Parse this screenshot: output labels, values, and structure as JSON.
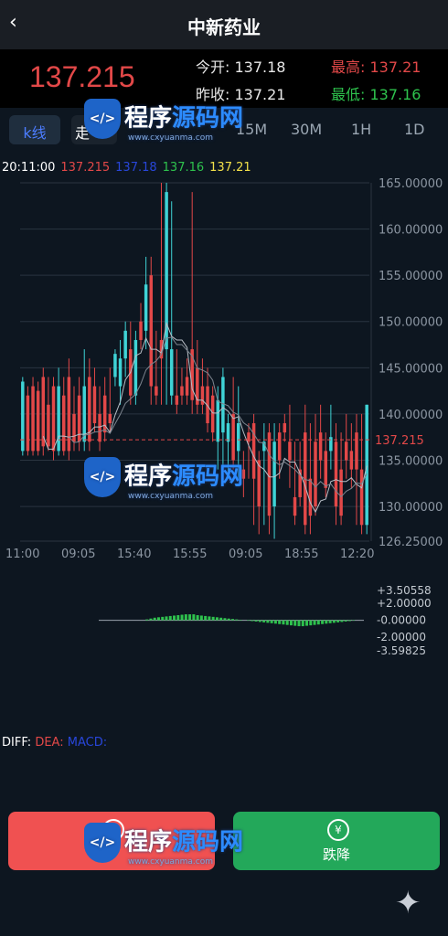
{
  "header": {
    "title": "中新药业",
    "back_icon": "chevron-left-icon"
  },
  "quote": {
    "price": "137.215",
    "open_label": "今开:",
    "open_value": "137.18",
    "high_label": "最高:",
    "high_value": "137.21",
    "prev_label": "昨收:",
    "prev_value": "137.21",
    "low_label": "最低:",
    "low_value": "137.16"
  },
  "tabs": [
    {
      "label": "k线",
      "active": true
    },
    {
      "label": "走"
    },
    {
      "label": "15M"
    },
    {
      "label": "30M"
    },
    {
      "label": "1H"
    },
    {
      "label": "1D"
    }
  ],
  "legend": {
    "time": "20:11:00",
    "v1": "137.215",
    "v2": "137.18",
    "v3": "137.16",
    "v4": "137.21"
  },
  "colors": {
    "up": "#e24848",
    "down": "#3fd3d6",
    "bg": "#0d1620",
    "high": "#e24848",
    "low": "#2ec24d",
    "legend_blue": "#2846d9",
    "legend_yellow": "#f2e04a"
  },
  "chart_data": {
    "type": "candlestick",
    "y_ticks": [
      "165.00000",
      "160.00000",
      "155.00000",
      "150.00000",
      "145.00000",
      "140.00000",
      "135.00000",
      "130.00000",
      "126.25000"
    ],
    "ylim": [
      126.25,
      165
    ],
    "x_ticks": [
      "11:00",
      "09:05",
      "15:40",
      "15:55",
      "09:05",
      "18:55",
      "12:20"
    ],
    "current_price_label": "137.215",
    "current_price": 137.215,
    "macd_ticks": [
      "+3.50558",
      "+2.00000",
      "-0.00000",
      "-2.00000",
      "-3.59825"
    ],
    "macd_ylim": [
      -3.59825,
      3.50558
    ],
    "macd_labels": {
      "diff": "DIFF:",
      "dea": "DEA:",
      "macd": "MACD:"
    },
    "candles": [
      {
        "o": 136,
        "c": 143.5,
        "h": 144,
        "l": 135.5
      },
      {
        "o": 142,
        "c": 136,
        "h": 143,
        "l": 135.5
      },
      {
        "o": 143,
        "c": 136,
        "h": 144,
        "l": 135.5
      },
      {
        "o": 142.5,
        "c": 136,
        "h": 143.5,
        "l": 135.5
      },
      {
        "o": 144,
        "c": 136.5,
        "h": 145,
        "l": 135.5
      },
      {
        "o": 141,
        "c": 136.5,
        "h": 144,
        "l": 136
      },
      {
        "o": 143,
        "c": 136,
        "h": 144,
        "l": 135
      },
      {
        "o": 136,
        "c": 143,
        "h": 145,
        "l": 135.5
      },
      {
        "o": 142,
        "c": 136,
        "h": 144,
        "l": 135.5
      },
      {
        "o": 144,
        "c": 136,
        "h": 146,
        "l": 135
      },
      {
        "o": 140,
        "c": 137,
        "h": 143,
        "l": 136
      },
      {
        "o": 142,
        "c": 137,
        "h": 144,
        "l": 136
      },
      {
        "o": 137,
        "c": 143,
        "h": 147,
        "l": 136
      },
      {
        "o": 144,
        "c": 137,
        "h": 146,
        "l": 136
      },
      {
        "o": 143,
        "c": 139,
        "h": 145,
        "l": 138
      },
      {
        "o": 140,
        "c": 137,
        "h": 143,
        "l": 136
      },
      {
        "o": 142,
        "c": 138,
        "h": 144,
        "l": 137
      },
      {
        "o": 140,
        "c": 139,
        "h": 145,
        "l": 138
      },
      {
        "o": 144,
        "c": 146.5,
        "h": 147,
        "l": 143
      },
      {
        "o": 143,
        "c": 146,
        "h": 148,
        "l": 141
      },
      {
        "o": 146,
        "c": 149,
        "h": 150,
        "l": 144
      },
      {
        "o": 147,
        "c": 142,
        "h": 150,
        "l": 141
      },
      {
        "o": 142,
        "c": 148,
        "h": 149,
        "l": 141
      },
      {
        "o": 150,
        "c": 148,
        "h": 152,
        "l": 147
      },
      {
        "o": 149,
        "c": 154,
        "h": 157,
        "l": 147
      },
      {
        "o": 155,
        "c": 143,
        "h": 157,
        "l": 141
      },
      {
        "o": 143,
        "c": 142,
        "h": 149,
        "l": 141
      },
      {
        "o": 148,
        "c": 146,
        "h": 165,
        "l": 141
      },
      {
        "o": 147,
        "c": 164,
        "h": 165,
        "l": 141
      },
      {
        "o": 142,
        "c": 147,
        "h": 163,
        "l": 141
      },
      {
        "o": 142,
        "c": 141,
        "h": 147,
        "l": 140
      },
      {
        "o": 143,
        "c": 142,
        "h": 145,
        "l": 141
      },
      {
        "o": 144,
        "c": 142,
        "h": 146,
        "l": 141
      },
      {
        "o": 147,
        "c": 141.5,
        "h": 164,
        "l": 140
      },
      {
        "o": 145,
        "c": 141,
        "h": 148,
        "l": 140
      },
      {
        "o": 143,
        "c": 141,
        "h": 146,
        "l": 140
      },
      {
        "o": 143,
        "c": 139,
        "h": 145,
        "l": 138
      },
      {
        "o": 142,
        "c": 138,
        "h": 143,
        "l": 137
      },
      {
        "o": 137,
        "c": 141.5,
        "h": 143,
        "l": 134
      },
      {
        "o": 138,
        "c": 144,
        "h": 145,
        "l": 134
      },
      {
        "o": 137,
        "c": 139,
        "h": 140,
        "l": 133
      },
      {
        "o": 140,
        "c": 135,
        "h": 144,
        "l": 134
      },
      {
        "o": 136,
        "c": 139,
        "h": 143,
        "l": 133
      },
      {
        "o": 134,
        "c": 133,
        "h": 136,
        "l": 131
      },
      {
        "o": 138,
        "c": 137,
        "h": 139,
        "l": 133
      },
      {
        "o": 139,
        "c": 133,
        "h": 140,
        "l": 128
      },
      {
        "o": 135,
        "c": 130,
        "h": 136,
        "l": 127
      },
      {
        "o": 136,
        "c": 137,
        "h": 139,
        "l": 128
      },
      {
        "o": 138,
        "c": 129,
        "h": 139,
        "l": 127
      },
      {
        "o": 130,
        "c": 137,
        "h": 139,
        "l": 126.5
      },
      {
        "o": 138,
        "c": 135,
        "h": 139,
        "l": 133
      },
      {
        "o": 139,
        "c": 138,
        "h": 140,
        "l": 137
      },
      {
        "o": 137,
        "c": 135,
        "h": 141,
        "l": 132
      },
      {
        "o": 131,
        "c": 129,
        "h": 137,
        "l": 128
      },
      {
        "o": 134,
        "c": 131,
        "h": 137,
        "l": 130
      },
      {
        "o": 138,
        "c": 128,
        "h": 141,
        "l": 127
      },
      {
        "o": 133,
        "c": 129,
        "h": 139,
        "l": 127
      },
      {
        "o": 137,
        "c": 130,
        "h": 140,
        "l": 129
      },
      {
        "o": 138,
        "c": 135,
        "h": 141,
        "l": 133
      },
      {
        "o": 136,
        "c": 132,
        "h": 138,
        "l": 131
      },
      {
        "o": 136,
        "c": 137.5,
        "h": 141,
        "l": 134
      },
      {
        "o": 137,
        "c": 130,
        "h": 139,
        "l": 128
      },
      {
        "o": 134,
        "c": 129,
        "h": 138,
        "l": 128
      },
      {
        "o": 137,
        "c": 135,
        "h": 140,
        "l": 133
      },
      {
        "o": 136,
        "c": 134,
        "h": 139,
        "l": 132
      },
      {
        "o": 138,
        "c": 134,
        "h": 140,
        "l": 128
      },
      {
        "o": 134,
        "c": 128,
        "h": 140,
        "l": 127
      },
      {
        "o": 128,
        "c": 141,
        "h": 141,
        "l": 127
      }
    ],
    "macd_hist": [
      0,
      0,
      0,
      0,
      0,
      0,
      0,
      0,
      0,
      0,
      0,
      0,
      0.1,
      0.2,
      0.3,
      0.35,
      0.4,
      0.45,
      0.5,
      0.55,
      0.6,
      0.65,
      0.7,
      0.7,
      0.7,
      0.6,
      0.55,
      0.5,
      0.45,
      0.4,
      0.35,
      0.3,
      0.25,
      0.2,
      0.15,
      0.1,
      0.05,
      0,
      -0.05,
      -0.1,
      -0.15,
      -0.2,
      -0.25,
      -0.3,
      -0.35,
      -0.4,
      -0.45,
      -0.5,
      -0.55,
      -0.6,
      -0.65,
      -0.7,
      -0.7,
      -0.65,
      -0.6,
      -0.55,
      -0.5,
      -0.45,
      -0.4,
      -0.35,
      -0.3,
      -0.25,
      -0.2,
      -0.15,
      -0.1,
      -0.05,
      0,
      0
    ]
  },
  "buttons": {
    "up_label": "",
    "down_label": "跌降",
    "down_icon": "yen-circle-icon"
  },
  "watermark": {
    "text_a": "程序",
    "text_b": "源码网",
    "sub": "www.cxyuanma.com"
  }
}
